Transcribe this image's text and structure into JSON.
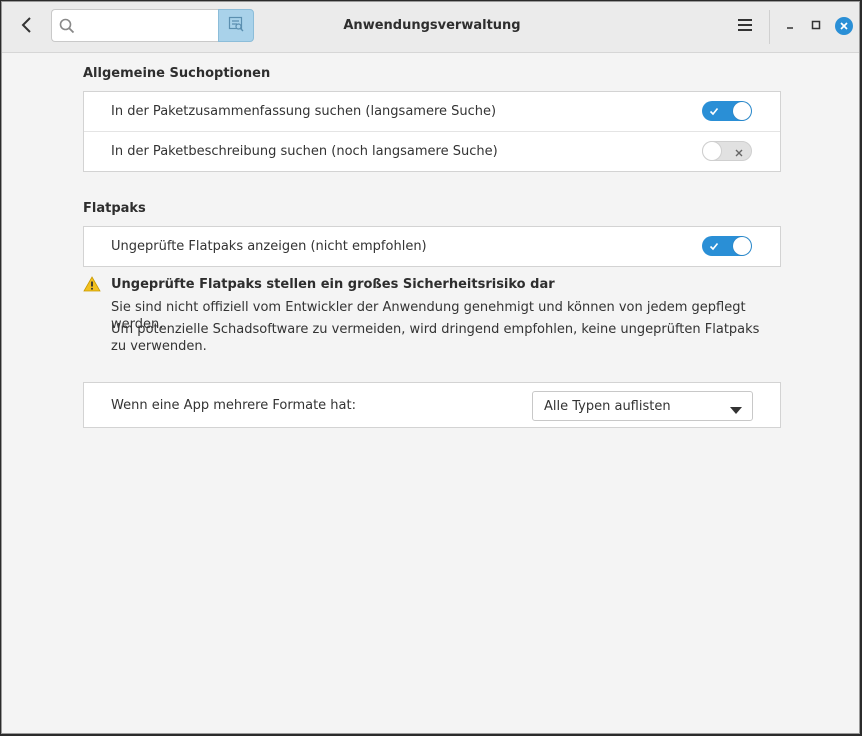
{
  "header": {
    "title": "Anwendungsverwaltung",
    "search": {
      "value": "",
      "placeholder": ""
    }
  },
  "icons": {
    "back": "back-arrow-icon",
    "search": "search-icon",
    "search_toggle": "search-in-description-icon",
    "menu": "hamburger-menu-icon",
    "minimize": "minimize-icon",
    "maximize": "maximize-icon",
    "close": "close-icon",
    "warning": "warning-triangle-icon"
  },
  "colors": {
    "accent": "#2a8fd6",
    "switch_off": "#e1e1e1",
    "warning": "#f2c01e"
  },
  "sections": {
    "search_options": {
      "title": "Allgemeine Suchoptionen",
      "rows": [
        {
          "label": "In der Paketzusammenfassung suchen (langsamere Suche)",
          "enabled": true
        },
        {
          "label": "In der Paketbeschreibung suchen (noch langsamere Suche)",
          "enabled": false
        }
      ]
    },
    "flatpaks": {
      "title": "Flatpaks",
      "rows": [
        {
          "label": "Ungeprüfte Flatpaks anzeigen (nicht empfohlen)",
          "enabled": true
        }
      ],
      "warning": {
        "title": "Ungeprüfte Flatpaks stellen ein großes Sicherheitsrisiko dar",
        "line1": "Sie sind nicht offiziell vom Entwickler der Anwendung genehmigt und können von jedem gepflegt werden.",
        "line2": "Um potenzielle Schadsoftware zu vermeiden, wird dringend empfohlen, keine ungeprüften Flatpaks zu verwenden."
      }
    },
    "formats": {
      "label": "Wenn eine App mehrere Formate hat:",
      "selected": "Alle Typen auflisten"
    }
  }
}
